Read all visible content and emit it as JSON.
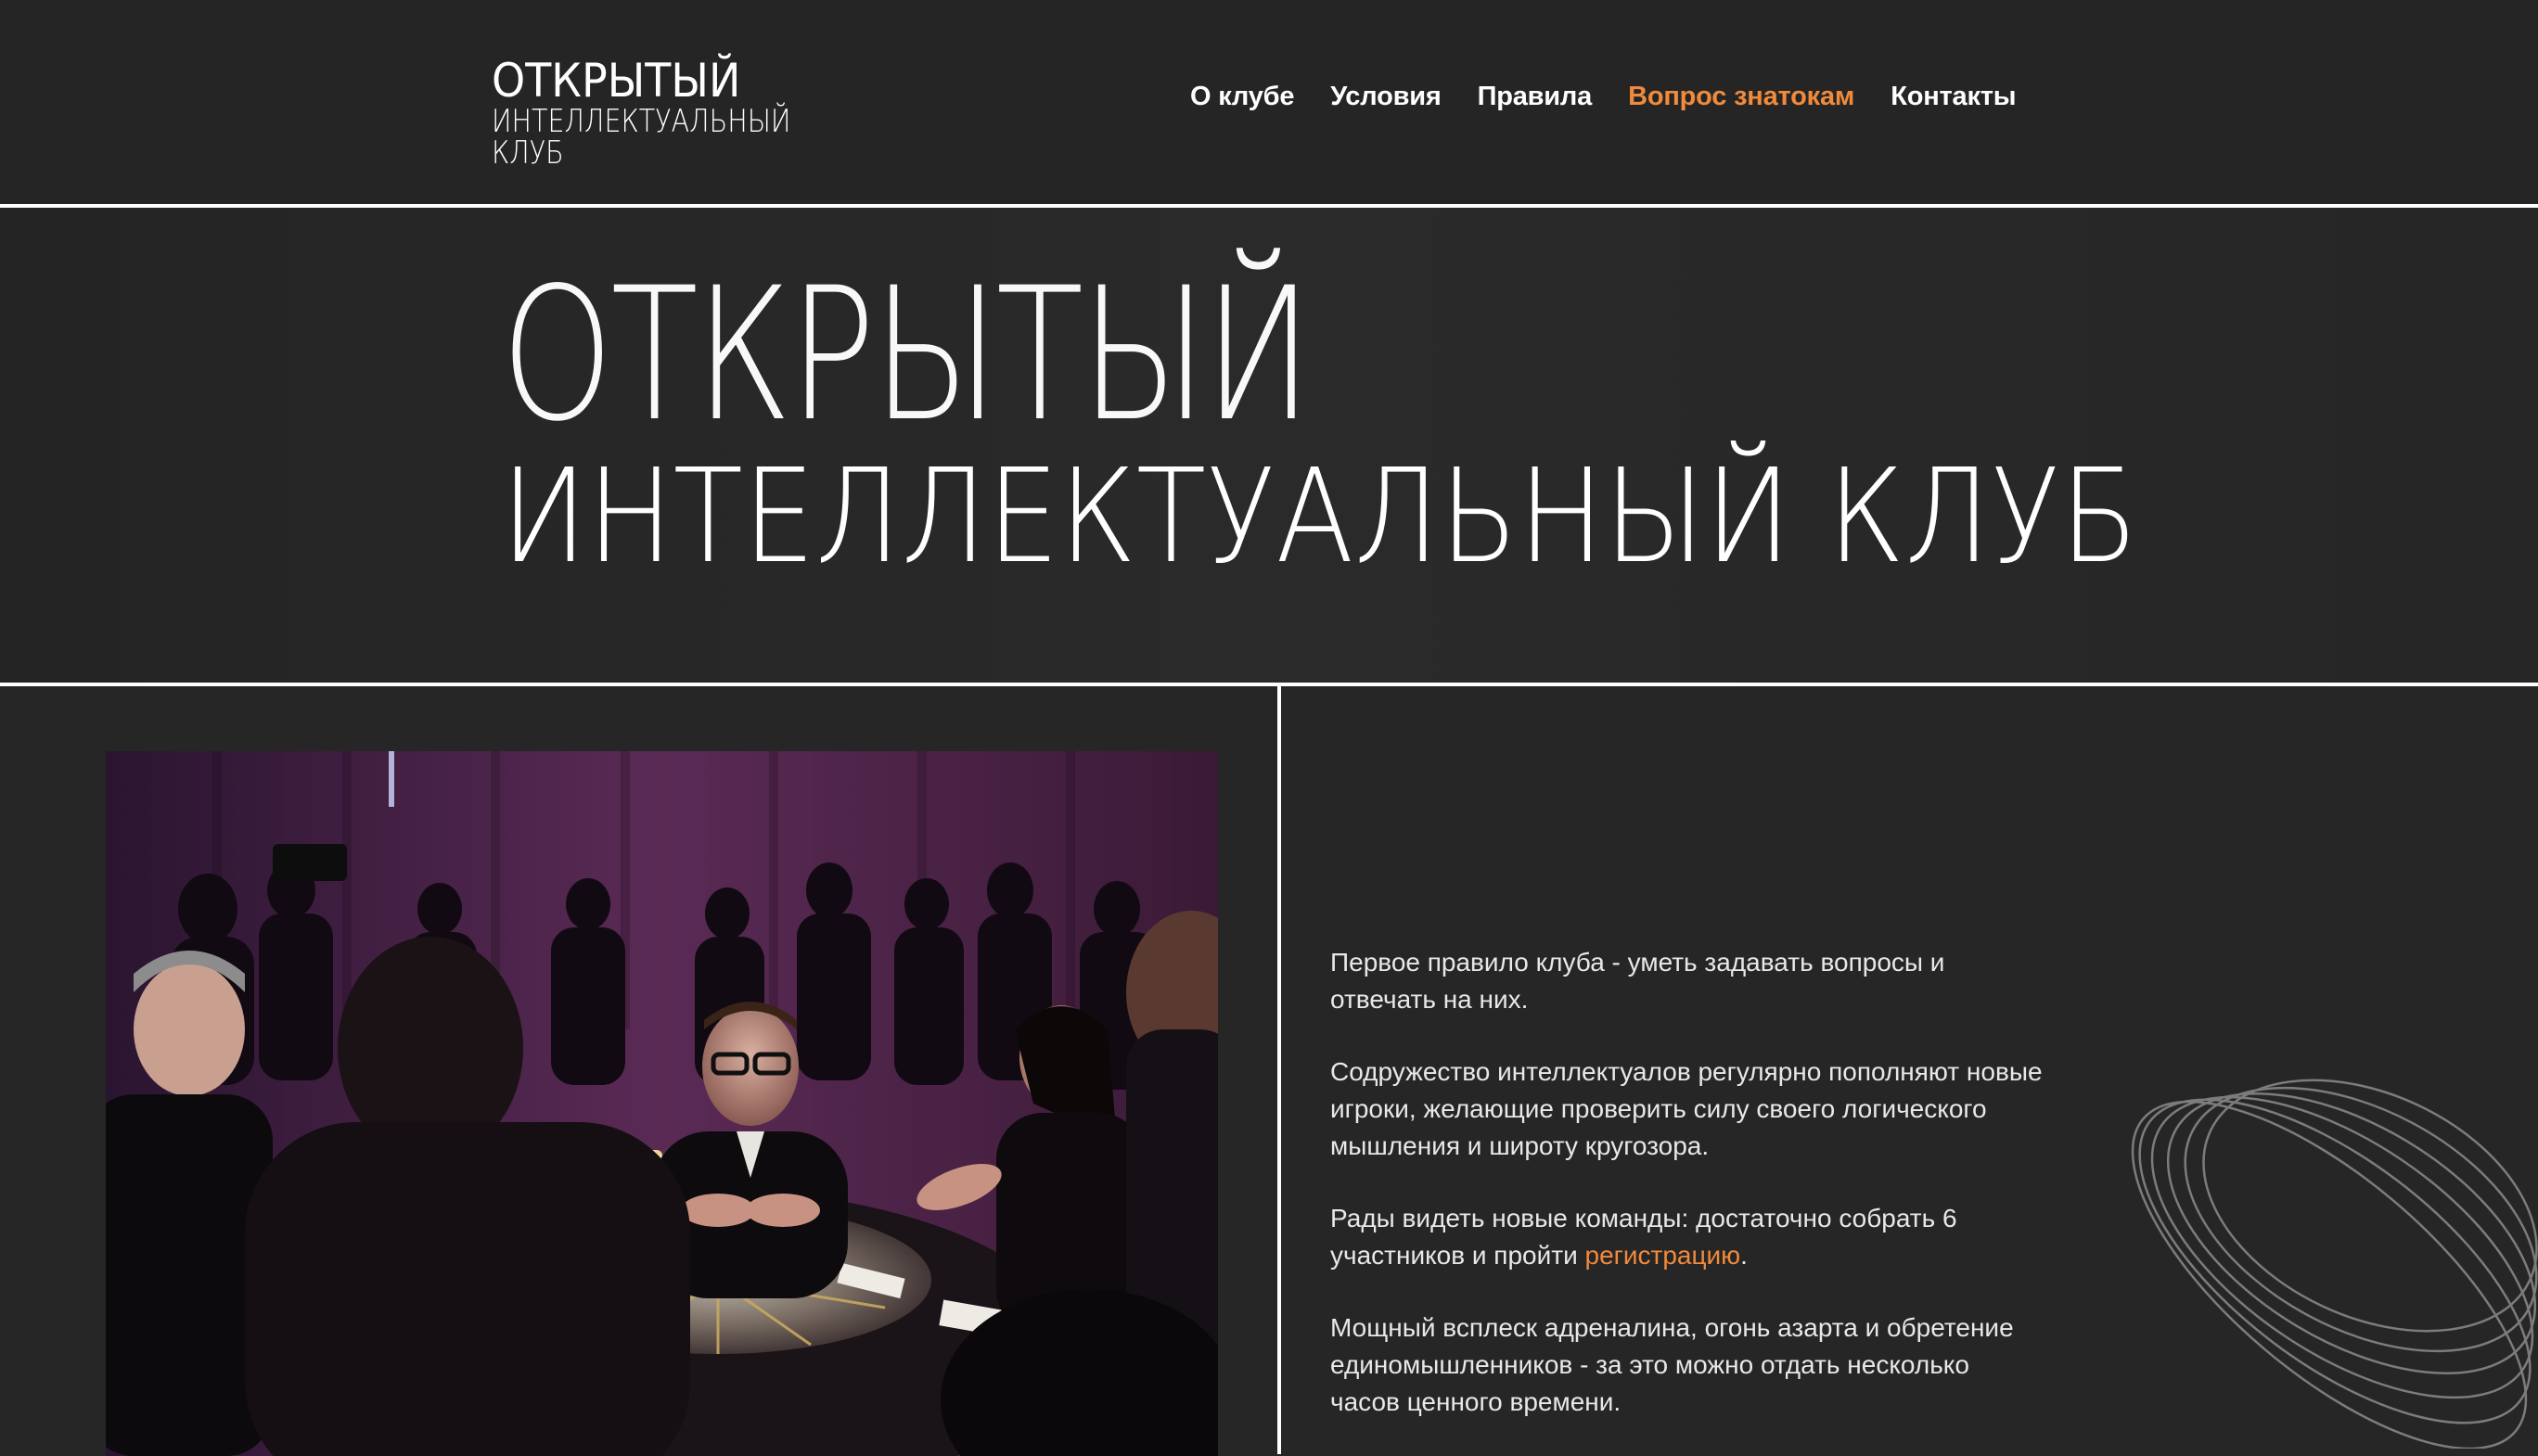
{
  "logo": {
    "line1": "Открытый",
    "line2": "интеллектуальный клуб"
  },
  "nav": [
    {
      "label": "О клубе",
      "active": false
    },
    {
      "label": "Условия",
      "active": false
    },
    {
      "label": "Правила",
      "active": false
    },
    {
      "label": "Вопрос знатокам",
      "active": true
    },
    {
      "label": "Контакты",
      "active": false
    }
  ],
  "hero": {
    "title_line1": "Открытый",
    "title_line2": "интеллектуальный клуб"
  },
  "about": {
    "p1": "Первое правило клуба - уметь задавать вопросы и отвечать на них.",
    "p2": "Содружество интеллектуалов регулярно пополняют новые игроки, желающие проверить силу своего логического мышления и широту кругозора.",
    "p3_before": "Рады видеть новые команды: достаточно собрать 6 участников и пройти ",
    "p3_link": "регистрацию",
    "p3_after": ".",
    "p4": "Мощный всплеск адреналина, огонь азарта и обретение единомышленников - за это можно отдать несколько часов ценного времени."
  },
  "colors": {
    "background": "#262626",
    "accent": "#f08a3c",
    "text": "#ffffff"
  },
  "icons": {
    "decoration": "orbit-rings-decoration"
  }
}
